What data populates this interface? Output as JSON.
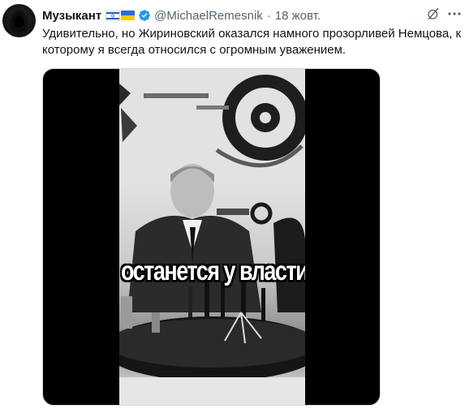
{
  "tweet": {
    "author_name": "Музыкант",
    "flags": [
      "israel-flag-icon",
      "ukraine-flag-icon"
    ],
    "verified_icon": "verified-badge-icon",
    "handle": "@MichaelRemesnik",
    "separator": "·",
    "date": "18 жовт.",
    "text": "Удивительно, но Жириновский оказался намного прозорливей Немцова, к которому я всегда относился с огромным уважением.",
    "action_icons": [
      "grok-icon",
      "more-icon"
    ]
  },
  "media": {
    "type": "video",
    "caption": "останется у власти"
  },
  "colors": {
    "text_primary": "#0f1419",
    "text_secondary": "#536471",
    "verified_blue": "#1d9bf0",
    "media_background": "#000000"
  }
}
